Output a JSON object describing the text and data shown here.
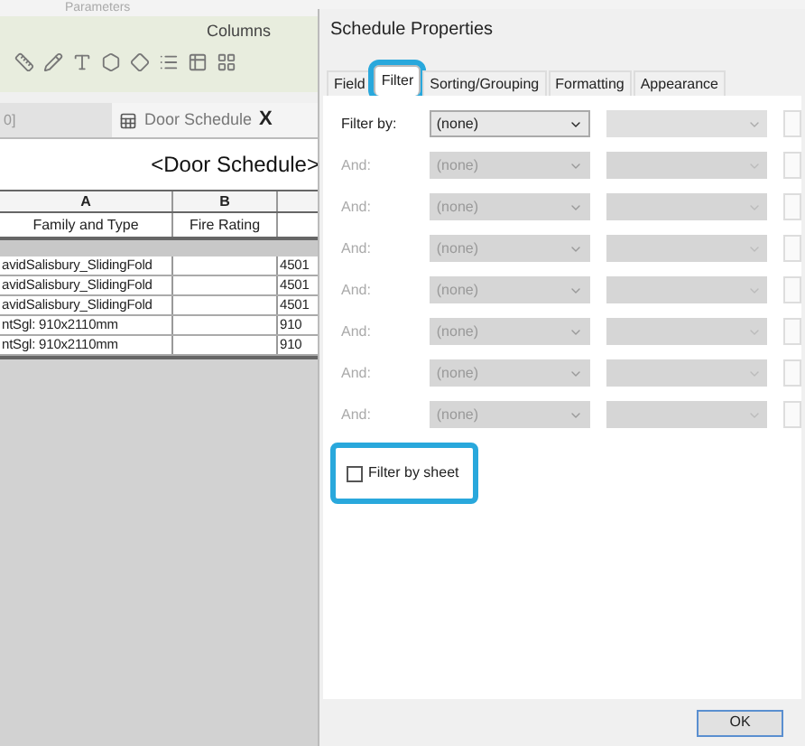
{
  "ribbon": {
    "top_labels": [
      "Parameters"
    ],
    "panel_title": "Columns"
  },
  "view_tabs": {
    "left_fragment": "0]",
    "active_tab": "Door Schedule",
    "close": "X"
  },
  "schedule": {
    "title": "<Door Schedule>",
    "column_letters": [
      "A",
      "B"
    ],
    "headers": [
      "Family and Type",
      "Fire Rating"
    ],
    "rows": [
      [
        "avidSalisbury_SlidingFold",
        "",
        "4501"
      ],
      [
        "avidSalisbury_SlidingFold",
        "",
        "4501"
      ],
      [
        "avidSalisbury_SlidingFold",
        "",
        "4501"
      ],
      [
        "ntSgl: 910x2110mm",
        "",
        "910"
      ],
      [
        "ntSgl: 910x2110mm",
        "",
        "910"
      ]
    ]
  },
  "dialog": {
    "title": "Schedule Properties",
    "tabs": [
      {
        "label": "Field",
        "selected": false,
        "highlighted": false
      },
      {
        "label": "Filter",
        "selected": true,
        "highlighted": true
      },
      {
        "label": "Sorting/Grouping",
        "selected": false,
        "highlighted": false
      },
      {
        "label": "Formatting",
        "selected": false,
        "highlighted": false
      },
      {
        "label": "Appearance",
        "selected": false,
        "highlighted": false
      }
    ],
    "filters": [
      {
        "label": "Filter by:",
        "value": "(none)",
        "disabled": false
      },
      {
        "label": "And:",
        "value": "(none)",
        "disabled": true
      },
      {
        "label": "And:",
        "value": "(none)",
        "disabled": true
      },
      {
        "label": "And:",
        "value": "(none)",
        "disabled": true
      },
      {
        "label": "And:",
        "value": "(none)",
        "disabled": true
      },
      {
        "label": "And:",
        "value": "(none)",
        "disabled": true
      },
      {
        "label": "And:",
        "value": "(none)",
        "disabled": true
      },
      {
        "label": "And:",
        "value": "(none)",
        "disabled": true
      }
    ],
    "filter_by_sheet": {
      "label": "Filter by sheet",
      "checked": false,
      "highlighted": true
    },
    "buttons": [
      "OK"
    ]
  }
}
